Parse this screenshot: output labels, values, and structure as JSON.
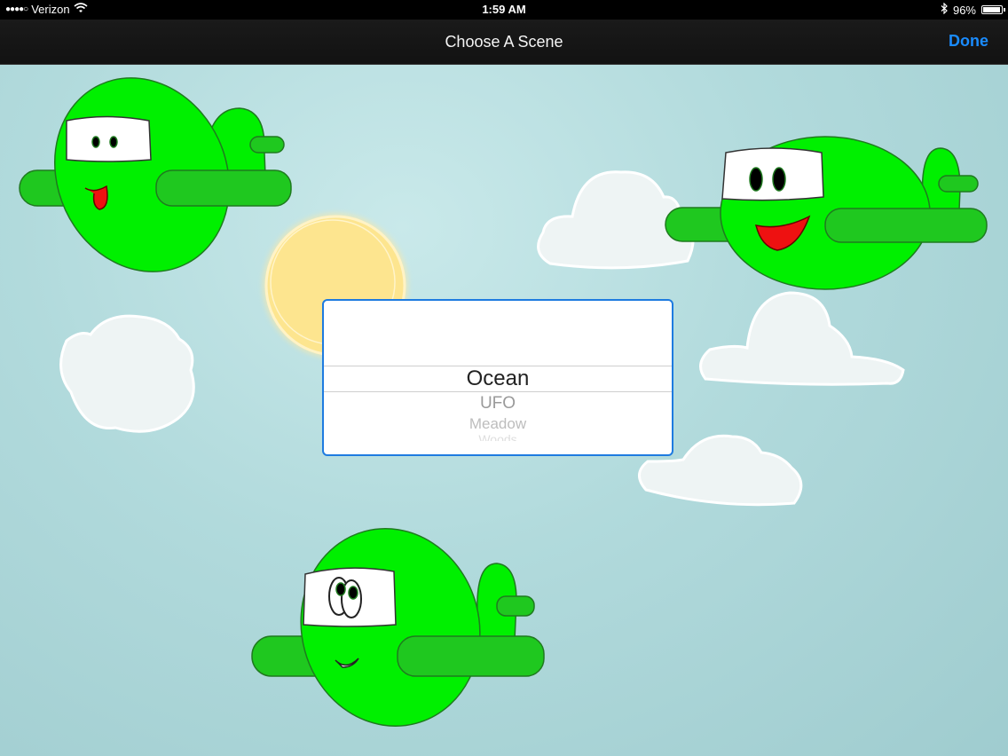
{
  "status_bar": {
    "carrier": "Verizon",
    "time": "1:59 AM",
    "battery_percent": "96%",
    "battery_level": 0.96,
    "icons": [
      "signal-dots-icon",
      "wifi-icon",
      "bluetooth-icon",
      "battery-icon"
    ]
  },
  "nav": {
    "title": "Choose A Scene",
    "done_label": "Done",
    "accent_color": "#1a8cff"
  },
  "picker": {
    "selected": "Ocean",
    "options": [
      "Ocean",
      "UFO",
      "Meadow",
      "Woods"
    ],
    "border_color": "#1e7be0"
  },
  "scene": {
    "plane_color": "#00f000",
    "sun_color": "#fde58f",
    "sky_color": "#b1dadc"
  }
}
